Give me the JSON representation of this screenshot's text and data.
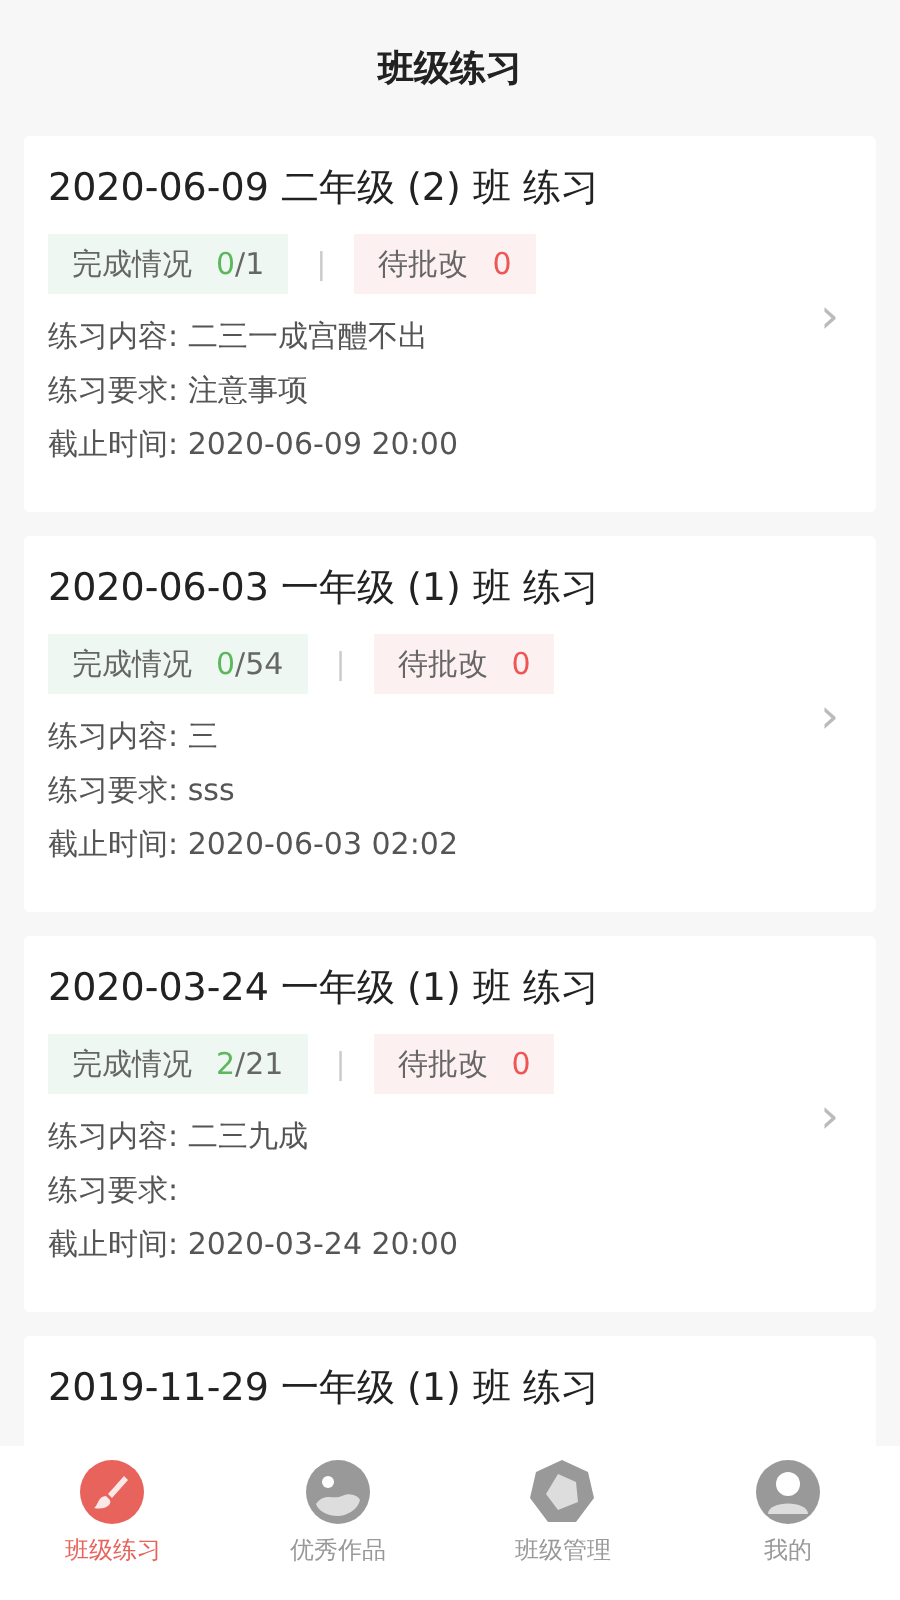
{
  "header": {
    "title": "班级练习"
  },
  "cards": [
    {
      "title": "2020-06-09 二年级 (2) 班 练习",
      "progress": {
        "label": "完成情况",
        "done": "0",
        "rest": "/1"
      },
      "separator": "|",
      "pending": {
        "label": "待批改",
        "count": "0"
      },
      "details": [
        {
          "label": "练习内容:",
          "value": "二三一成宫醴不出"
        },
        {
          "label": "练习要求:",
          "value": "注意事项"
        },
        {
          "label": "截止时间:",
          "value": "2020-06-09 20:00"
        }
      ],
      "chevron": "›"
    },
    {
      "title": "2020-06-03 一年级 (1) 班 练习",
      "progress": {
        "label": "完成情况",
        "done": "0",
        "rest": "/54"
      },
      "separator": "|",
      "pending": {
        "label": "待批改",
        "count": "0"
      },
      "details": [
        {
          "label": "练习内容:",
          "value": "三"
        },
        {
          "label": "练习要求:",
          "value": "sss"
        },
        {
          "label": "截止时间:",
          "value": "2020-06-03 02:02"
        }
      ],
      "chevron": "›"
    },
    {
      "title": "2020-03-24 一年级 (1) 班 练习",
      "progress": {
        "label": "完成情况",
        "done": "2",
        "rest": "/21"
      },
      "separator": "|",
      "pending": {
        "label": "待批改",
        "count": "0"
      },
      "details": [
        {
          "label": "练习内容:",
          "value": "二三九成"
        },
        {
          "label": "练习要求:"
        },
        {
          "label": "截止时间:",
          "value": "2020-03-24 20:00"
        }
      ],
      "chevron": "›"
    },
    {
      "title": "2019-11-29 一年级 (1) 班 练习"
    }
  ],
  "tabbar": [
    {
      "label": "班级练习",
      "kind": "brush",
      "selected": true
    },
    {
      "label": "优秀作品",
      "kind": "gallery",
      "selected": false
    },
    {
      "label": "班级管理",
      "kind": "polygon",
      "selected": false
    },
    {
      "label": "我的",
      "kind": "person",
      "selected": false
    }
  ]
}
